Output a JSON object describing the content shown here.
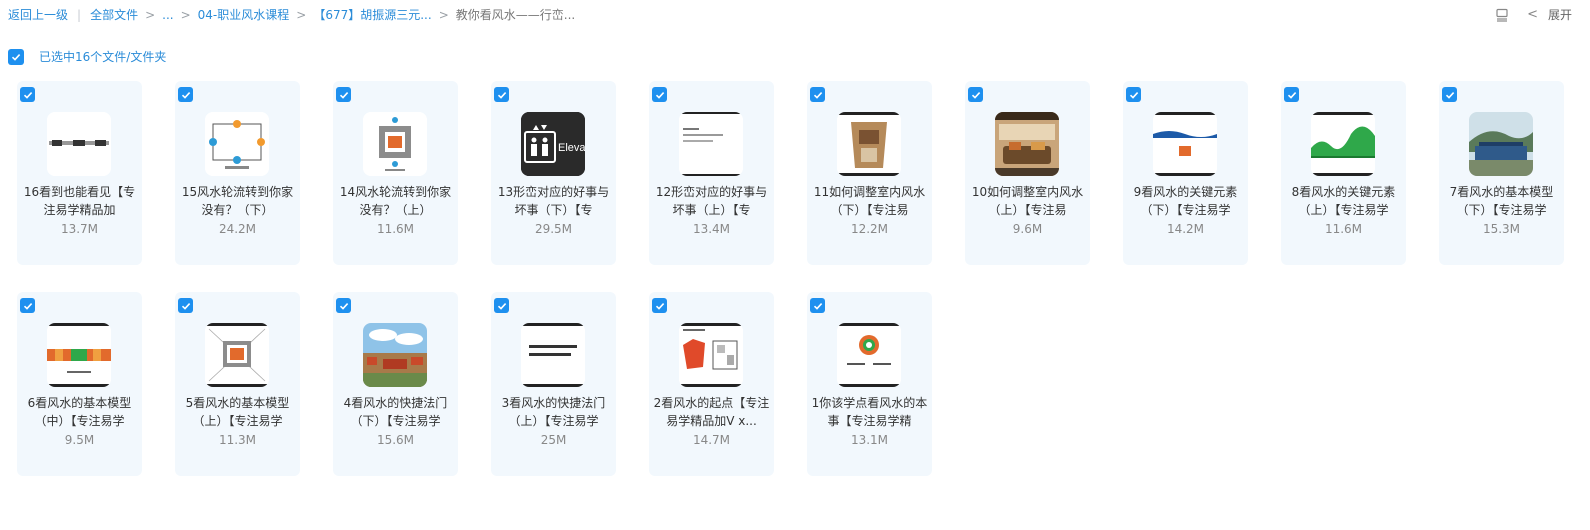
{
  "breadcrumb": {
    "back": "返回上一级",
    "all_files": "全部文件",
    "ellipsis": "...",
    "folder_1": "04-职业风水课程",
    "folder_2": "【677】胡振源三元...",
    "current": "教你看风水——行峦..."
  },
  "toolbar": {
    "expand_label": "展开",
    "layout_icon": "list-layout-icon",
    "collapse_icon": "chevron-left-icon"
  },
  "selection": {
    "label": "已选中16个文件/文件夹"
  },
  "colors": {
    "accent": "#1e90ef",
    "card_bg": "#f2f8fd",
    "link": "#2b8cd8"
  },
  "files": [
    {
      "name": "16看到也能看见【专注易学精品加",
      "size": "13.7M"
    },
    {
      "name": "15风水轮流转到你家没有？（下）",
      "size": "24.2M"
    },
    {
      "name": "14风水轮流转到你家没有？（上）",
      "size": "11.6M"
    },
    {
      "name": "13形峦对应的好事与坏事（下）【专",
      "size": "29.5M",
      "thumb_text": "Elevat"
    },
    {
      "name": "12形峦对应的好事与坏事（上）【专",
      "size": "13.4M"
    },
    {
      "name": "11如何调整室内风水（下）【专注易",
      "size": "12.2M"
    },
    {
      "name": "10如何调整室内风水（上）【专注易",
      "size": "9.6M"
    },
    {
      "name": "9看风水的关键元素（下）【专注易学",
      "size": "14.2M"
    },
    {
      "name": "8看风水的关键元素（上）【专注易学",
      "size": "11.6M"
    },
    {
      "name": "7看风水的基本模型（下）【专注易学",
      "size": "15.3M"
    },
    {
      "name": "6看风水的基本模型（中）【专注易学",
      "size": "9.5M"
    },
    {
      "name": "5看风水的基本模型（上）【专注易学",
      "size": "11.3M"
    },
    {
      "name": "4看风水的快捷法门（下）【专注易学",
      "size": "15.6M"
    },
    {
      "name": "3看风水的快捷法门（上）【专注易学",
      "size": "25M"
    },
    {
      "name": "2看风水的起点【专注易学精品加V x...",
      "size": "14.7M"
    },
    {
      "name": "1你该学点看风水的本事【专注易学精",
      "size": "13.1M"
    }
  ]
}
